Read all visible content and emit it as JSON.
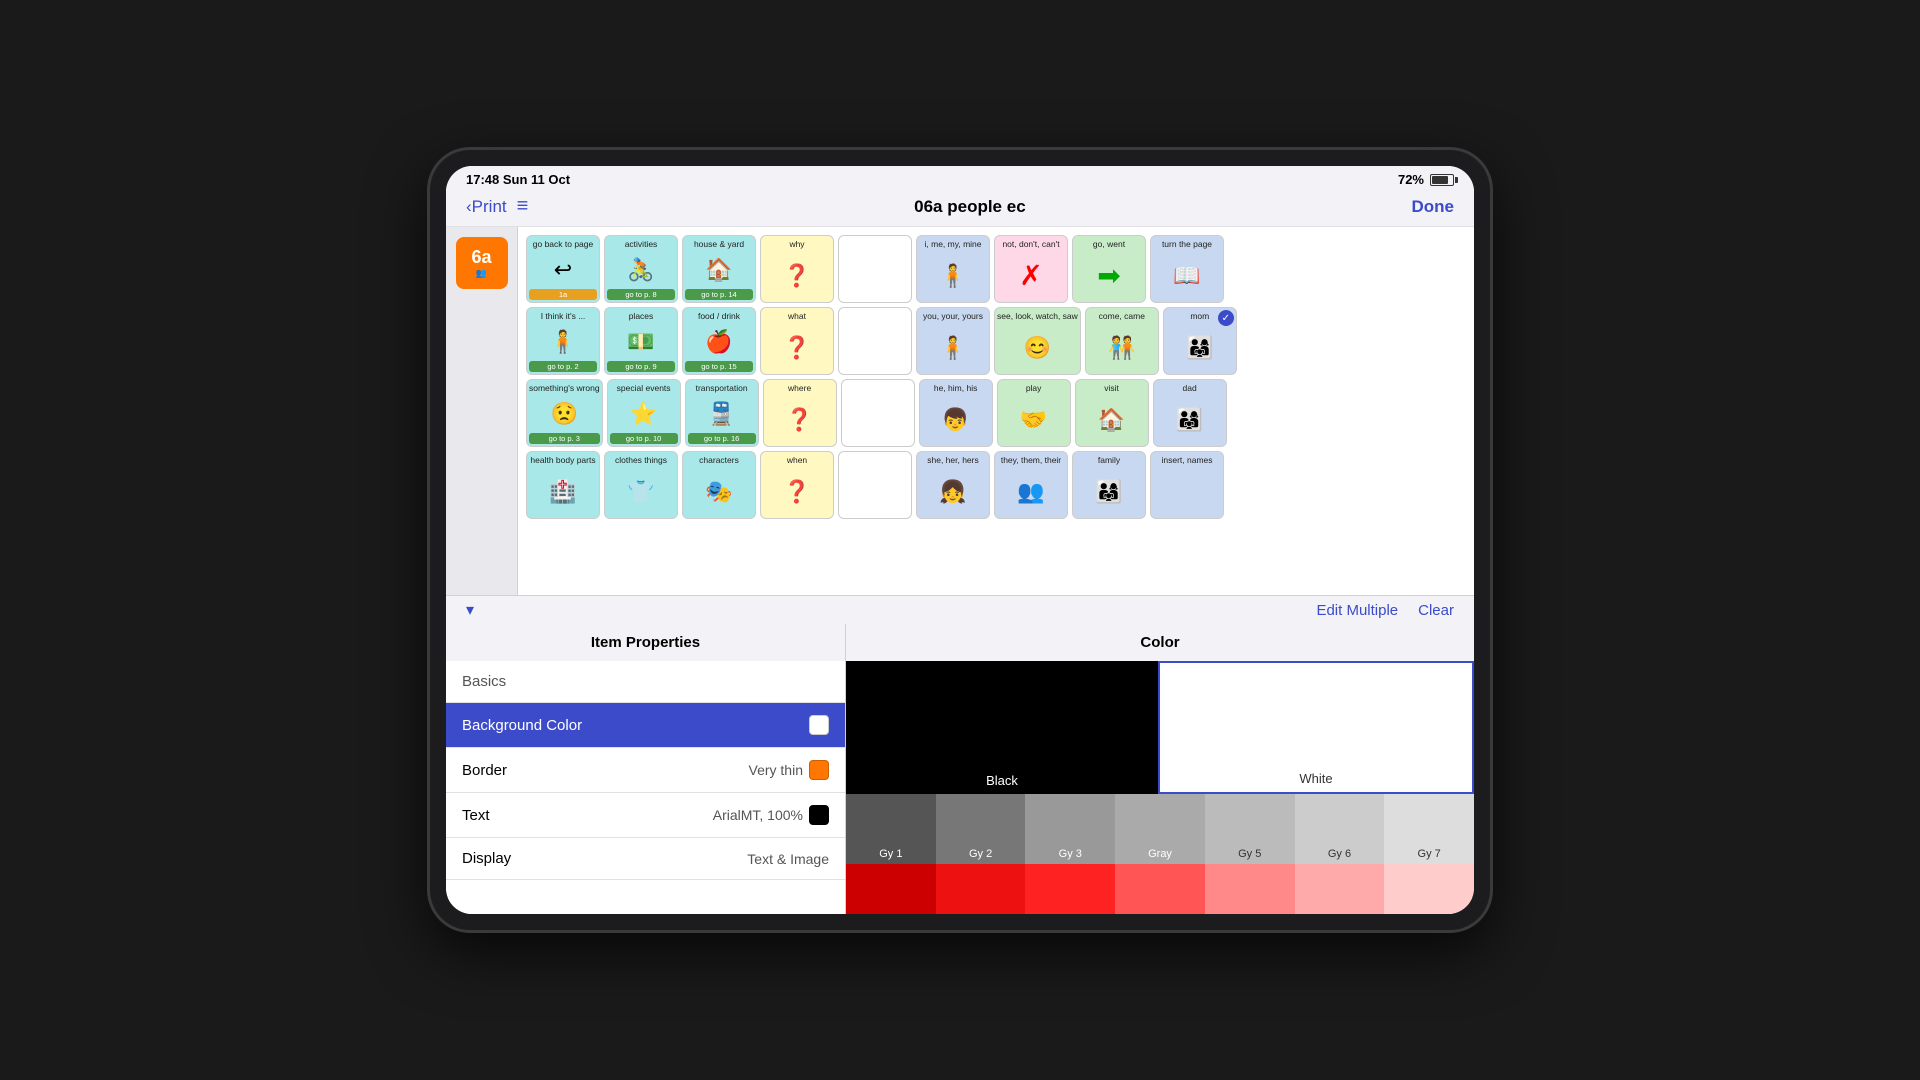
{
  "device": {
    "time": "17:48",
    "date": "Sun 11 Oct",
    "battery": "72%"
  },
  "nav": {
    "back_label": "Print",
    "title": "06a people ec",
    "done_label": "Done"
  },
  "grid": {
    "cells": [
      [
        {
          "label": "go back to page",
          "sublabel": "1a",
          "icon": "↩",
          "bg": "teal"
        },
        {
          "label": "activities",
          "sublabel": "go to p. 8",
          "icon": "🚴",
          "bg": "teal"
        },
        {
          "label": "house & yard",
          "sublabel": "go to p. 14",
          "icon": "🏠",
          "bg": "teal"
        },
        {
          "label": "why",
          "icon": "❓",
          "bg": "yellow"
        },
        {
          "label": "",
          "icon": "",
          "bg": ""
        },
        {
          "label": "i, me, my, mine",
          "icon": "🧍",
          "bg": "blue"
        },
        {
          "label": "not, don't, can't",
          "icon": "✗",
          "bg": "pink"
        },
        {
          "label": "go, went",
          "icon": "➡️",
          "bg": "green"
        },
        {
          "label": "turn the page",
          "icon": "📖",
          "bg": "blue"
        }
      ],
      [
        {
          "label": "I think it's ...",
          "sublabel": "go to p. 2",
          "icon": "🧍",
          "bg": "teal"
        },
        {
          "label": "places",
          "sublabel": "go to p. 9",
          "icon": "💵",
          "bg": "teal"
        },
        {
          "label": "food / drink",
          "sublabel": "go to p. 15",
          "icon": "🍎",
          "bg": "teal"
        },
        {
          "label": "what",
          "icon": "❓",
          "bg": "yellow"
        },
        {
          "label": "",
          "icon": "",
          "bg": ""
        },
        {
          "label": "you, your, yours",
          "icon": "🧍",
          "bg": "blue"
        },
        {
          "label": "see, look, watch, saw",
          "icon": "😊",
          "bg": "green"
        },
        {
          "label": "come, came",
          "icon": "🧑‍🤝‍🧑",
          "bg": "green"
        },
        {
          "label": "mom",
          "icon": "👨‍👩‍👧",
          "bg": "blue",
          "checkmark": true
        }
      ],
      [
        {
          "label": "something's wrong",
          "sublabel": "go to p. 3",
          "icon": "😟",
          "bg": "teal"
        },
        {
          "label": "special events",
          "sublabel": "go to p. 10",
          "icon": "⭐",
          "bg": "teal"
        },
        {
          "label": "transportation",
          "sublabel": "go to p. 16",
          "icon": "🚆",
          "bg": "teal"
        },
        {
          "label": "where",
          "icon": "❓",
          "bg": "yellow"
        },
        {
          "label": "",
          "icon": "",
          "bg": ""
        },
        {
          "label": "he, him, his",
          "icon": "👦",
          "bg": "blue"
        },
        {
          "label": "play",
          "icon": "🤝",
          "bg": "green"
        },
        {
          "label": "visit",
          "icon": "🏠",
          "bg": "green"
        },
        {
          "label": "dad",
          "icon": "👨‍👩‍👧",
          "bg": "blue"
        }
      ],
      [
        {
          "label": "health body parts",
          "sublabel": "",
          "icon": "🏥",
          "bg": "teal"
        },
        {
          "label": "clothes things",
          "sublabel": "",
          "icon": "👕",
          "bg": "teal"
        },
        {
          "label": "characters",
          "sublabel": "",
          "icon": "🎭",
          "bg": "teal"
        },
        {
          "label": "when",
          "icon": "❓",
          "bg": "yellow"
        },
        {
          "label": "",
          "icon": "",
          "bg": ""
        },
        {
          "label": "she, her, hers",
          "icon": "👧",
          "bg": "blue"
        },
        {
          "label": "they, them, their",
          "icon": "👥",
          "bg": "blue"
        },
        {
          "label": "family",
          "icon": "👨‍👩‍👧",
          "bg": "blue"
        },
        {
          "label": "insert, names",
          "icon": "",
          "bg": "blue"
        }
      ]
    ]
  },
  "collapse": {
    "icon": "▾"
  },
  "edit_actions": {
    "edit_multiple": "Edit Multiple",
    "clear": "Clear"
  },
  "properties": {
    "header": "Item Properties",
    "basics_label": "Basics",
    "rows": [
      {
        "label": "Background Color",
        "value": "",
        "swatch": "#ffffff",
        "active": true
      },
      {
        "label": "Border",
        "value": "Very thin",
        "swatch": "#ff7700"
      },
      {
        "label": "Text",
        "value": "ArialMT, 100%",
        "swatch": "#000000"
      },
      {
        "label": "Display",
        "value": "Text & Image",
        "swatch": null
      }
    ]
  },
  "color_panel": {
    "header": "Color",
    "black_label": "Black",
    "white_label": "White",
    "grays": [
      {
        "label": "Gy 1",
        "color": "#555555"
      },
      {
        "label": "Gy 2",
        "color": "#777777"
      },
      {
        "label": "Gy 3",
        "color": "#999999"
      },
      {
        "label": "Gray",
        "color": "#aaaaaa"
      },
      {
        "label": "Gy 5",
        "color": "#bbbbbb"
      },
      {
        "label": "Gy 6",
        "color": "#cccccc"
      },
      {
        "label": "Gy 7",
        "color": "#dddddd"
      }
    ],
    "reds": [
      {
        "color": "#cc0000"
      },
      {
        "color": "#ee1111"
      },
      {
        "color": "#ff2222"
      },
      {
        "color": "#ff5555"
      },
      {
        "color": "#ff8888"
      },
      {
        "color": "#ffaaaa"
      },
      {
        "color": "#ffcccc"
      }
    ]
  },
  "sidebar": {
    "page_label": "6a",
    "page_sub": "👥"
  }
}
